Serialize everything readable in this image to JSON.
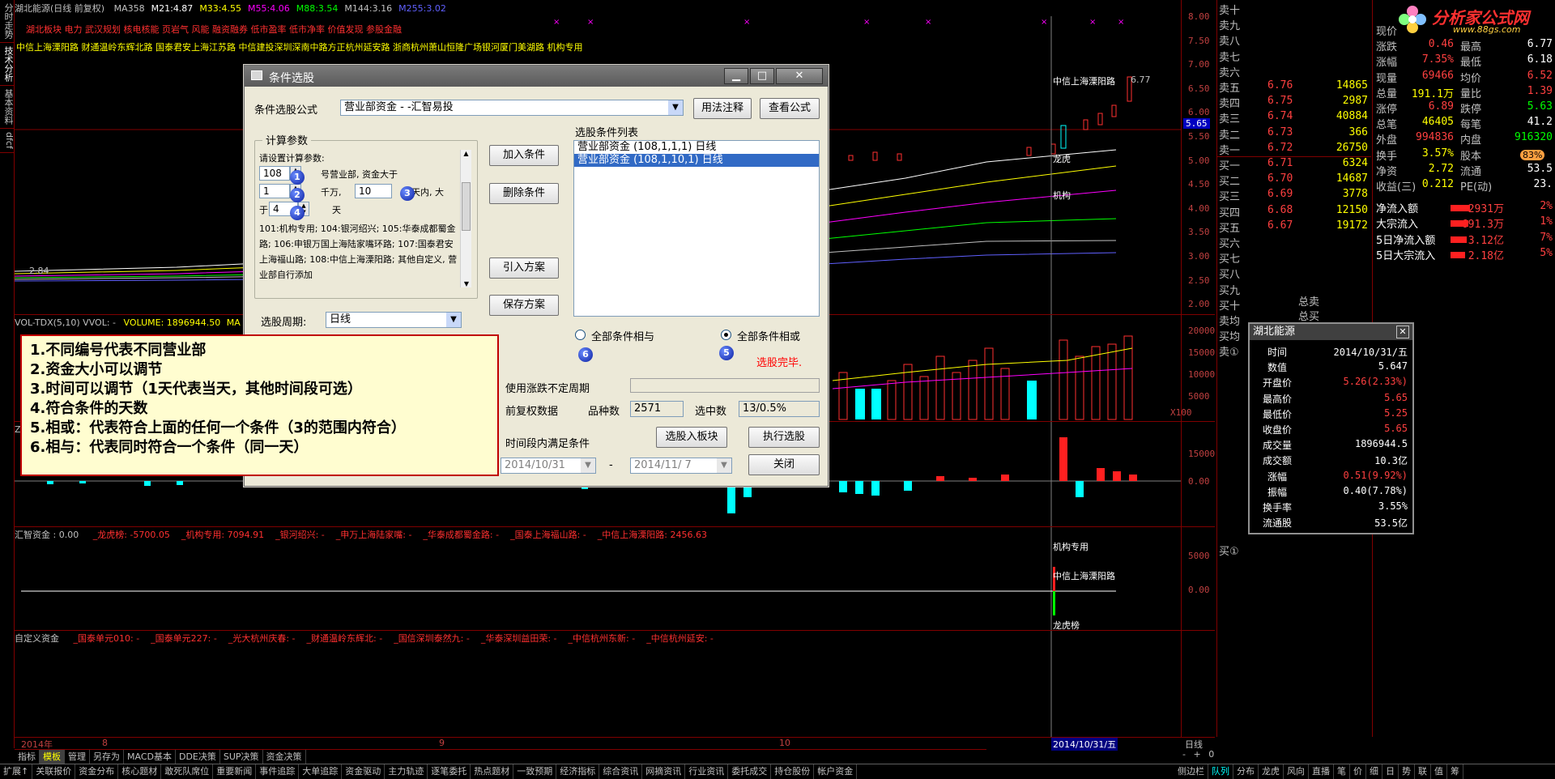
{
  "left_tabs": [
    "分时走势",
    "技术分析",
    "基本资料",
    "dfcf"
  ],
  "chart": {
    "header": {
      "name": "湖北能源(日线 前复权)",
      "ma": [
        {
          "label": "MA358",
          "value": "",
          "color": "#c0c0c0"
        },
        {
          "label": "M21:",
          "value": "4.87",
          "color": "#ffffff"
        },
        {
          "label": "M33:",
          "value": "4.55",
          "color": "#ffff00"
        },
        {
          "label": "M55:",
          "value": "4.06",
          "color": "#ff00ff"
        },
        {
          "label": "M88:",
          "value": "3.54",
          "color": "#00ff00"
        },
        {
          "label": "M144:",
          "value": "3.16",
          "color": "#c0c0c0"
        },
        {
          "label": "M255:",
          "value": "3.02",
          "color": "#6060ff"
        }
      ]
    },
    "concepts": "湖北板块 电力 武汉规划 核电核能 页岩气 风能 融资融券 低市盈率 低市净率 价值发现 参股金融",
    "brokers_line": "中信上海溧阳路 财通温岭东辉北路 国泰君安上海江苏路 中信建投深圳深南中路方正杭州延安路 浙商杭州萧山恒隆广场银河厦门美湖路 机构专用",
    "price_axis": [
      "8.00",
      "7.50",
      "7.00",
      "6.50",
      "6.00",
      "5.50",
      "5.00",
      "4.50",
      "4.00",
      "3.50",
      "3.00",
      "2.50",
      "2.00"
    ],
    "last_marker": "5.65",
    "high_label": "6.77",
    "low_label": "2.84",
    "annotations": {
      "broker": "中信上海溧阳路",
      "dragon": "龙虎",
      "inst": "机构"
    },
    "vol_header": {
      "label": "VOL-TDX(5,10) VVOL: -",
      "value": "VOLUME: 1896944.50",
      "ma": "MA"
    },
    "vol_axis": [
      "20000",
      "15000",
      "10000",
      "5000",
      "X100"
    ],
    "z_axis": [
      "15000",
      "0.00"
    ],
    "hz_header": {
      "label": "汇智资金 : 0.00",
      "items": [
        "_龙虎榜: -5700.05",
        "_机构专用: 7094.91",
        "_银河绍兴: -",
        "_申万上海陆家嘴: -",
        "_华泰成都蜀金路: -",
        "_国泰上海福山路: -",
        "_中信上海溧阳路: 2456.63"
      ]
    },
    "hz_axis": [
      "5000",
      "0.00"
    ],
    "hz_annotations": {
      "inst": "机构专用",
      "broker": "中信上海溧阳路",
      "dragon": "龙虎榜"
    },
    "custom_header": {
      "label": "自定义资金",
      "items": [
        "_国泰单元010: -",
        "_国泰单元227: -",
        "_光大杭州庆春: -",
        "_财通温岭东辉北: -",
        "_国信深圳泰然九: -",
        "_华泰深圳益田荣: -",
        "_中信杭州东新: -",
        "_中信杭州延安: -"
      ]
    },
    "x_axis": {
      "year": "2014年",
      "months": [
        "8",
        "9",
        "10"
      ],
      "cursor_date": "2014/10/31/五",
      "period": "日线"
    }
  },
  "orderbook": {
    "sell_labels": [
      "卖十",
      "卖九",
      "卖八",
      "卖七",
      "卖六"
    ],
    "sell": [
      {
        "label": "卖五",
        "price": "6.76",
        "vol": "14865"
      },
      {
        "label": "卖四",
        "price": "6.75",
        "vol": "2987"
      },
      {
        "label": "卖三",
        "price": "6.74",
        "vol": "40884"
      },
      {
        "label": "卖二",
        "price": "6.73",
        "vol": "366"
      },
      {
        "label": "卖一",
        "price": "6.72",
        "vol": "26750"
      }
    ],
    "buy": [
      {
        "label": "买一",
        "price": "6.71",
        "vol": "6324"
      },
      {
        "label": "买二",
        "price": "6.70",
        "vol": "14687"
      },
      {
        "label": "买三",
        "price": "6.69",
        "vol": "3778"
      },
      {
        "label": "买四",
        "price": "6.68",
        "vol": "12150"
      },
      {
        "label": "买五",
        "price": "6.67",
        "vol": "19172"
      }
    ],
    "buy_labels": [
      "买六",
      "买七",
      "买八",
      "买九",
      "买十"
    ],
    "bottom_labels": [
      "卖均",
      "买均",
      "卖①"
    ],
    "total_sell": "总卖",
    "total_buy": "总买",
    "buy_marker": "买①"
  },
  "stats": {
    "logo_text": "分析家公式网",
    "logo_url": "www.88gs.com",
    "rows": [
      {
        "k1": "现价",
        "v1": "",
        "k2": "",
        "v2": ""
      },
      {
        "k1": "涨跌",
        "v1": "0.46",
        "k2": "最高",
        "v2": "6.77"
      },
      {
        "k1": "涨幅",
        "v1": "7.35%",
        "k2": "最低",
        "v2": "6.18"
      },
      {
        "k1": "现量",
        "v1": "69466",
        "k2": "均价",
        "v2": "6.52"
      },
      {
        "k1": "总量",
        "v1": "191.1万",
        "k2": "量比",
        "v2": "1.39"
      },
      {
        "k1": "涨停",
        "v1": "6.89",
        "k2": "跌停",
        "v2": "5.63"
      },
      {
        "k1": "总笔",
        "v1": "46405",
        "k2": "每笔",
        "v2": "41.2"
      },
      {
        "k1": "外盘",
        "v1": "994836",
        "k2": "内盘",
        "v2": "916320"
      },
      {
        "k1": "换手",
        "v1": "3.57%",
        "k2": "股本",
        "v2": ""
      },
      {
        "k1": "净资",
        "v1": "2.72",
        "k2": "流通",
        "v2": "53.5"
      },
      {
        "k1": "收益(三)",
        "v1": "0.212",
        "k2": "PE(动)",
        "v2": "23."
      }
    ],
    "flows": [
      {
        "k": "净流入额",
        "v": "2931万",
        "p": "2%"
      },
      {
        "k": "大宗流入",
        "v": "691.3万",
        "p": "1%"
      },
      {
        "k": "5日净流入额",
        "v": "3.12亿",
        "p": "7%"
      },
      {
        "k": "5日大宗流入",
        "v": "2.18亿",
        "p": "5%"
      }
    ],
    "badge": "83%"
  },
  "dialog": {
    "title": "条件选股",
    "formula_label": "条件选股公式",
    "formula_value": "营业部资金 - -汇智易投",
    "btn_usage": "用法注释",
    "btn_view": "查看公式",
    "params_group": "计算参数",
    "params_prompt": "请设置计算参数:",
    "p1_value": "108",
    "p1_suffix": "号营业部, 资金大于",
    "p2_value": "1",
    "p2_unit": "千万,",
    "p3_value": "10",
    "p3_suffix": "天内, 大",
    "p4_prefix": "于",
    "p4_value": "4",
    "p4_suffix": "天",
    "params_desc": "101:机构专用; 104:银河绍兴; 105:华泰成都蜀金路; 106:申银万国上海陆家嘴环路; 107:国泰君安上海福山路; 108:中信上海溧阳路; 其他自定义, 营业部自行添加",
    "btn_add": "加入条件",
    "btn_delete": "删除条件",
    "btn_import": "引入方案",
    "btn_save": "保存方案",
    "list_label": "选股条件列表",
    "conditions": [
      "营业部资金 (108,1,1,1) 日线",
      "营业部资金 (108,1,10,1) 日线"
    ],
    "period_label": "选股周期:",
    "period_value": "日线",
    "radio_and": "全部条件相与",
    "radio_or": "全部条件相或",
    "status": "选股完毕.",
    "opt_change": "使用涨跌不定周期",
    "opt_adjust": "前复权数据",
    "count_label": "品种数",
    "count_value": "2571",
    "selected_label": "选中数",
    "selected_value": "13/0.5%",
    "opt_range": "时间段内满足条件",
    "btn_to_block": "选股入板块",
    "btn_run": "执行选股",
    "date_from": "2014/10/31",
    "date_sep": "-",
    "date_to": "2014/11/ 7",
    "btn_close": "关闭",
    "badges": [
      "1",
      "2",
      "3",
      "4",
      "5",
      "6"
    ]
  },
  "notes": [
    "1.不同编号代表不同营业部",
    "2.资金大小可以调节",
    "3.时间可以调节（1天代表当天，其他时间段可选）",
    "4.符合条件的天数",
    "5.相或：代表符合上面的任何一个条件（3的范围内符合）",
    "6.相与：代表同时符合一个条件（同一天）"
  ],
  "info_popup": {
    "title": "湖北能源",
    "rows": [
      {
        "k": "时间",
        "v": "2014/10/31/五",
        "c": "#ffffff"
      },
      {
        "k": "数值",
        "v": "5.647",
        "c": "#ffffff"
      },
      {
        "k": "开盘价",
        "v": "5.26(2.33%)",
        "c": "#ff4040"
      },
      {
        "k": "最高价",
        "v": "5.65",
        "c": "#ff4040"
      },
      {
        "k": "最低价",
        "v": "5.25",
        "c": "#ff4040"
      },
      {
        "k": "收盘价",
        "v": "5.65",
        "c": "#ff4040"
      },
      {
        "k": "成交量",
        "v": "1896944.5",
        "c": "#ffffff"
      },
      {
        "k": "成交额",
        "v": "10.3亿",
        "c": "#ffffff"
      },
      {
        "k": "涨幅",
        "v": "0.51(9.92%)",
        "c": "#ff4040"
      },
      {
        "k": "振幅",
        "v": "0.40(7.78%)",
        "c": "#ffffff"
      },
      {
        "k": "换手率",
        "v": "3.55%",
        "c": "#ffffff"
      },
      {
        "k": "流通股",
        "v": "53.5亿",
        "c": "#ffffff"
      }
    ]
  },
  "bottom_tabs": [
    "指标",
    "模板",
    "管理",
    "另存为",
    "MACD基本",
    "DDE决策",
    "SUP决策",
    "资金决策"
  ],
  "bottom_right": [
    "-",
    "+",
    "0"
  ],
  "status_items": [
    "扩展↑",
    "关联报价",
    "资金分布",
    "核心题材",
    "敢死队席位",
    "重要新闻",
    "事件追踪",
    "大单追踪",
    "资金驱动",
    "主力轨迹",
    "逐笔委托",
    "热点题材",
    "一致预期",
    "经济指标",
    "综合资讯",
    "网摘资讯",
    "行业资讯",
    "委托成交",
    "持仓股份",
    "帐户资金"
  ],
  "status_right": [
    "侧边栏",
    "队列",
    "分布",
    "龙虎",
    "风向",
    "直播",
    "笔",
    "价",
    "细",
    "日",
    "势",
    "联",
    "值",
    "筹"
  ]
}
